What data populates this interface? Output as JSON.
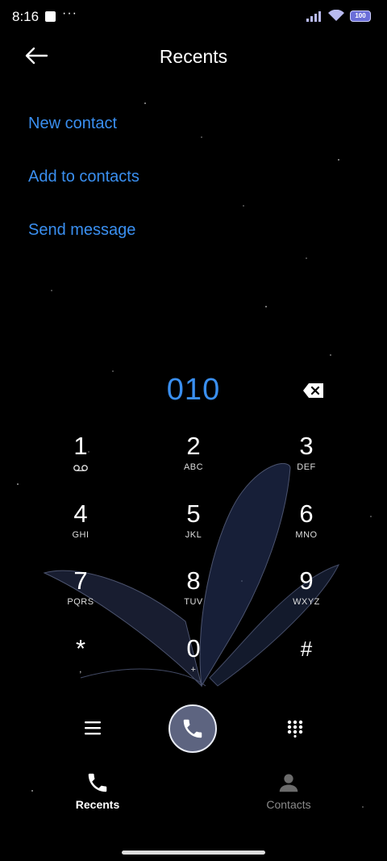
{
  "status_bar": {
    "time": "8:16",
    "more": "···",
    "battery": "100"
  },
  "header": {
    "title": "Recents"
  },
  "actions": {
    "new_contact": "New contact",
    "add_to_contacts": "Add to contacts",
    "send_message": "Send message"
  },
  "dialer": {
    "number": "010",
    "keys": [
      {
        "digit": "1",
        "letters": ""
      },
      {
        "digit": "2",
        "letters": "ABC"
      },
      {
        "digit": "3",
        "letters": "DEF"
      },
      {
        "digit": "4",
        "letters": "GHI"
      },
      {
        "digit": "5",
        "letters": "JKL"
      },
      {
        "digit": "6",
        "letters": "MNO"
      },
      {
        "digit": "7",
        "letters": "PQRS"
      },
      {
        "digit": "8",
        "letters": "TUV"
      },
      {
        "digit": "9",
        "letters": "WXYZ"
      },
      {
        "digit": "*",
        "letters": ","
      },
      {
        "digit": "0",
        "letters": "+"
      },
      {
        "digit": "#",
        "letters": ""
      }
    ]
  },
  "tabs": {
    "recents": "Recents",
    "contacts": "Contacts"
  },
  "colors": {
    "accent": "#3a8ff0",
    "call_button": "#5d6480",
    "background": "#000000"
  }
}
